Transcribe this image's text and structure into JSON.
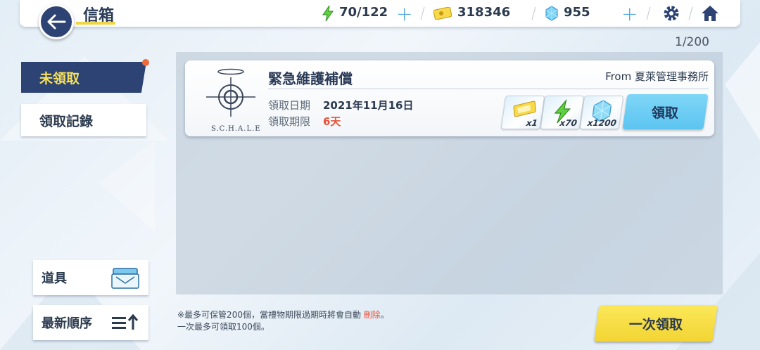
{
  "header": {
    "title": "信箱",
    "ap": "70/122",
    "credits": "318346",
    "gems": "955",
    "plus_label": "+"
  },
  "mail_count": "1/200",
  "tabs": {
    "unclaimed": "未領取",
    "history": "領取記錄"
  },
  "filter": {
    "items_label": "道具",
    "sort_label": "最新順序"
  },
  "mail": {
    "logo_text": "S.C.H.A.L.E",
    "title": "緊急維護補償",
    "from": "From 夏萊管理事務所",
    "date_label": "領取日期",
    "date_value": "2021年11月16日",
    "expire_label": "領取期限",
    "expire_value": "6天",
    "rewards": [
      {
        "icon": "credit-ticket-icon",
        "qty": "x1"
      },
      {
        "icon": "ap-lightning-icon",
        "qty": "x70"
      },
      {
        "icon": "pyroxene-gem-icon",
        "qty": "x1200"
      }
    ],
    "claim_label": "領取"
  },
  "footer": {
    "note_line1_prefix": "※最多可保管200個，當禮物期限過期時將會自動",
    "note_line1_delete": "刪除",
    "note_line1_suffix": "。",
    "note_line2": "一次最多可領取100個。",
    "claim_all_label": "一次領取"
  },
  "colors": {
    "accent_navy": "#2c4373",
    "accent_yellow": "#f3d433",
    "claim_blue": "#5cc4f0",
    "warning_red": "#e8533a"
  }
}
